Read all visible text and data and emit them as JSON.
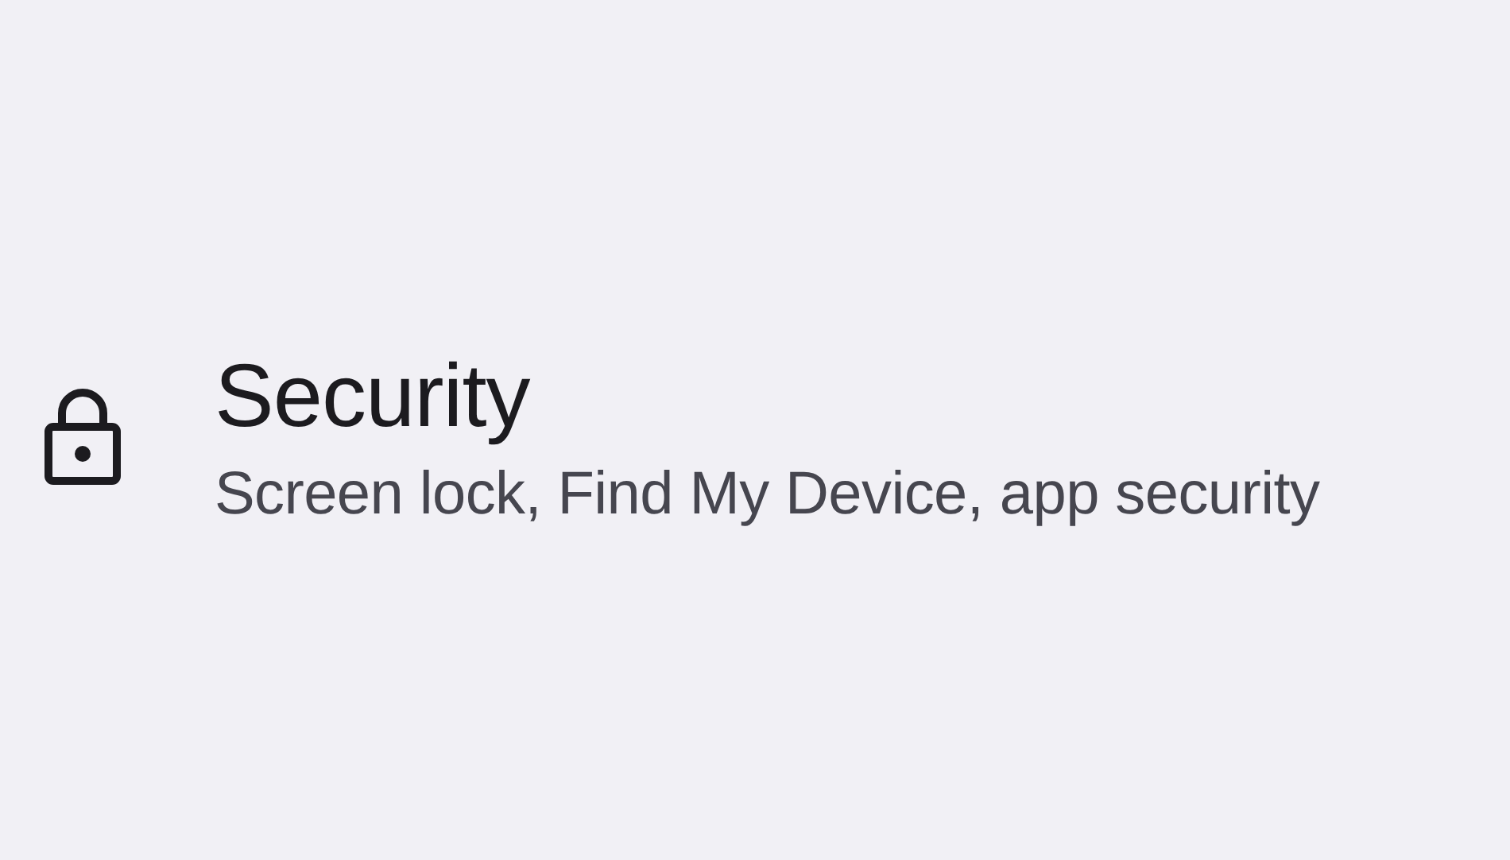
{
  "settings_item": {
    "title": "Security",
    "subtitle": "Screen lock, Find My Device, app security"
  }
}
